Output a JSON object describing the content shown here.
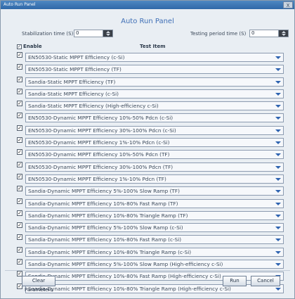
{
  "window": {
    "title": "Auto Run Panel",
    "close_glyph": "X"
  },
  "panel": {
    "title": "Auto Run Panel"
  },
  "settings": {
    "stabilization_label": "Stabilization time (S)",
    "stabilization_value": "0",
    "testing_label": "Testing period time (S)",
    "testing_value": "0"
  },
  "table": {
    "enable_header": "Enable",
    "test_header": "Test Item",
    "header_check": "✓",
    "rows": [
      "EN50530-Static MPPT Efficiency (c-Si)",
      "EN50530-Static MPPT Efficiency (TF)",
      "Sandia-Static MPPT Efficiency (TF)",
      "Sandia-Static MPPT Efficiency (c-Si)",
      "Sandia-Static MPPT Efficiency (High-efficiency c-Si)",
      "EN50530-Dynamic MPPT Efficiency 10%-50% Pdcn (c-Si)",
      "EN50530-Dynamic MPPT Efficiency 30%-100% Pdcn (c-Si)",
      "EN50530-Dynamic MPPT Efficiency 1%-10% Pdcn (c-Si)",
      "EN50530-Dynamic MPPT Efficiency 10%-50% Pdcn (TF)",
      "EN50530-Dynamic MPPT Efficiency 30%-100% Pdcn (TF)",
      "EN50530-Dynamic MPPT Efficiency 1%-10% Pdcn (TF)",
      "Sandia-Dynamic MPPT Efficiency 5%-100% Slow Ramp (TF)",
      "Sandia-Dynamic MPPT Efficiency 10%-80% Fast Ramp (TF)",
      "Sandia-Dynamic MPPT Efficiency 10%-80% Triangle Ramp (TF)",
      "Sandia-Dynamic MPPT Efficiency 5%-100% Slow Ramp (c-Si)",
      "Sandia-Dynamic MPPT Efficiency 10%-80% Fast Ramp (c-Si)",
      "Sandia-Dynamic MPPT Efficiency 10%-80% Triangle Ramp (c-Si)",
      "Sandia-Dynamic MPPT Efficiency 5%-100% Slow Ramp (High-efficiency c-Si)",
      "Sandia-Dynamic MPPT Efficiency 10%-80% Fast Ramp (High-efficiency c-Si)",
      "Sandia-Dynamic MPPT Efficiency 10%-80% Triangle Ramp (High-efficiency c-Si)"
    ]
  },
  "buttons": {
    "clear_all": "Clear Parameters",
    "run": "Run",
    "cancel": "Cancel"
  }
}
